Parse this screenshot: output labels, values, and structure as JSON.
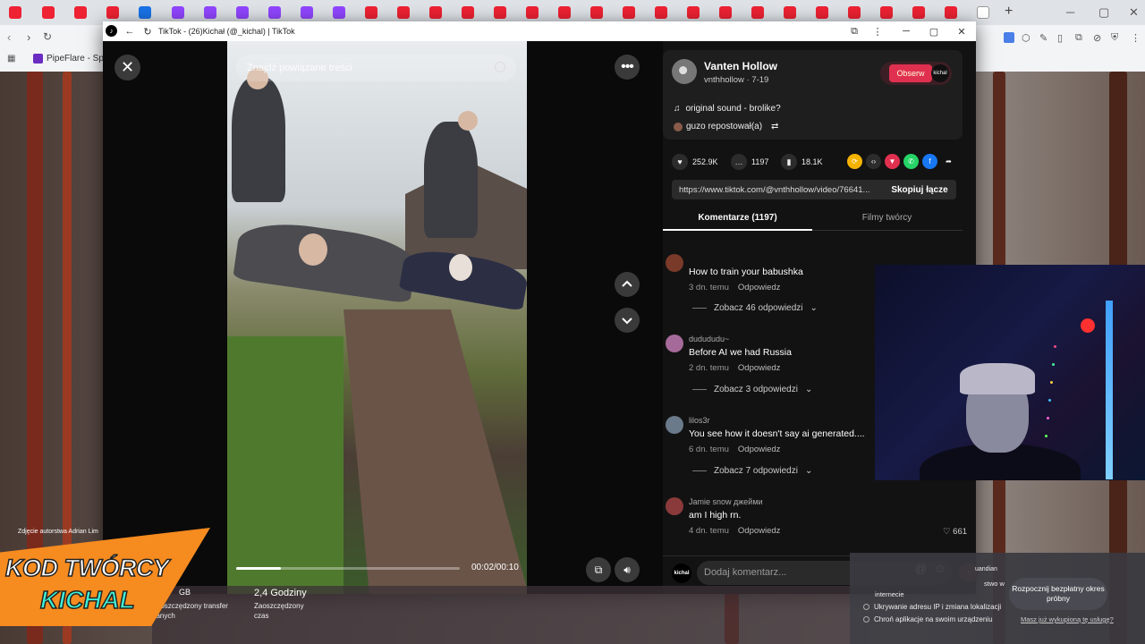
{
  "colors": {
    "accent_red": "#e0304f",
    "promo_orange": "#f68b1f",
    "promo_cyan": "#3ef2d8",
    "tiktok_dark": "#121212"
  },
  "browser_bg": {
    "bookmark": "PipeFlare - Społe"
  },
  "popup": {
    "title": "TikTok - (26)Kichał (@_kichal) | TikTok"
  },
  "video": {
    "search_placeholder": "Znajdź powiązane treści",
    "time": "00:02/00:10",
    "progress_fraction": 0.2
  },
  "author": {
    "name": "Vanten Hollow",
    "meta": "vnthhollow · 7-19",
    "follow_label": "Obserw",
    "follow_avatar": "kichal",
    "sound": "original sound - brolike?",
    "repost": "guzo repostował(a)"
  },
  "stats": {
    "likes": "252.9K",
    "comments": "1197",
    "saves": "18.1K"
  },
  "share": {
    "url": "https://www.tiktok.com/@vnthhollow/video/76641...",
    "copy_label": "Skopiuj łącze"
  },
  "tabs": [
    {
      "label": "Komentarze (1197)"
    },
    {
      "label": "Filmy twórcy"
    }
  ],
  "comments": [
    {
      "user": "",
      "text": "How to train your babushka",
      "date": "3 dn. temu",
      "reply": "Odpowiedz",
      "more": "Zobacz 46 odpowiedzi",
      "likes": ""
    },
    {
      "user": "dudududu~",
      "text": "Before AI we had Russia",
      "date": "2 dn. temu",
      "reply": "Odpowiedz",
      "more": "Zobacz 3 odpowiedzi",
      "likes": ""
    },
    {
      "user": "lilos3r",
      "text": "You see how it doesn't say ai generated....",
      "date": "6 dn. temu",
      "reply": "Odpowiedz",
      "more": "Zobacz 7 odpowiedzi",
      "likes": ""
    },
    {
      "user": "Jamie snow джейми",
      "text": "am I high rn.",
      "date": "4 dn. temu",
      "reply": "Odpowiedz",
      "more": "",
      "likes": "661"
    }
  ],
  "comment_bar": {
    "avatar": "kichal",
    "placeholder": "Dodaj komentarz..."
  },
  "promo": {
    "caption": "Zdjęcie autorstwa Adrian Lim",
    "line1": "KOD TWÓRCY",
    "line2": "KICHAL"
  },
  "bottom_strip": {
    "gb_unit": "GB",
    "gb_label1": "Zaoszczędzony transfer",
    "gb_label2": "danych",
    "hours": "2,4 Godziny",
    "hours_label1": "Zaoszczędzony",
    "hours_label2": "czas"
  },
  "vpn": {
    "top_right": "uandian",
    "partial1": "internecie",
    "partial2": "stwo w",
    "item1": "Ukrywanie adresu IP i zmiana lokalizacji",
    "item2": "Chroń aplikacje na swoim urządzeniu",
    "cta1": "Rozpocznij bezpłatny okres",
    "cta2": "próbny",
    "link": "Masz już wykupioną tę usługę?"
  }
}
